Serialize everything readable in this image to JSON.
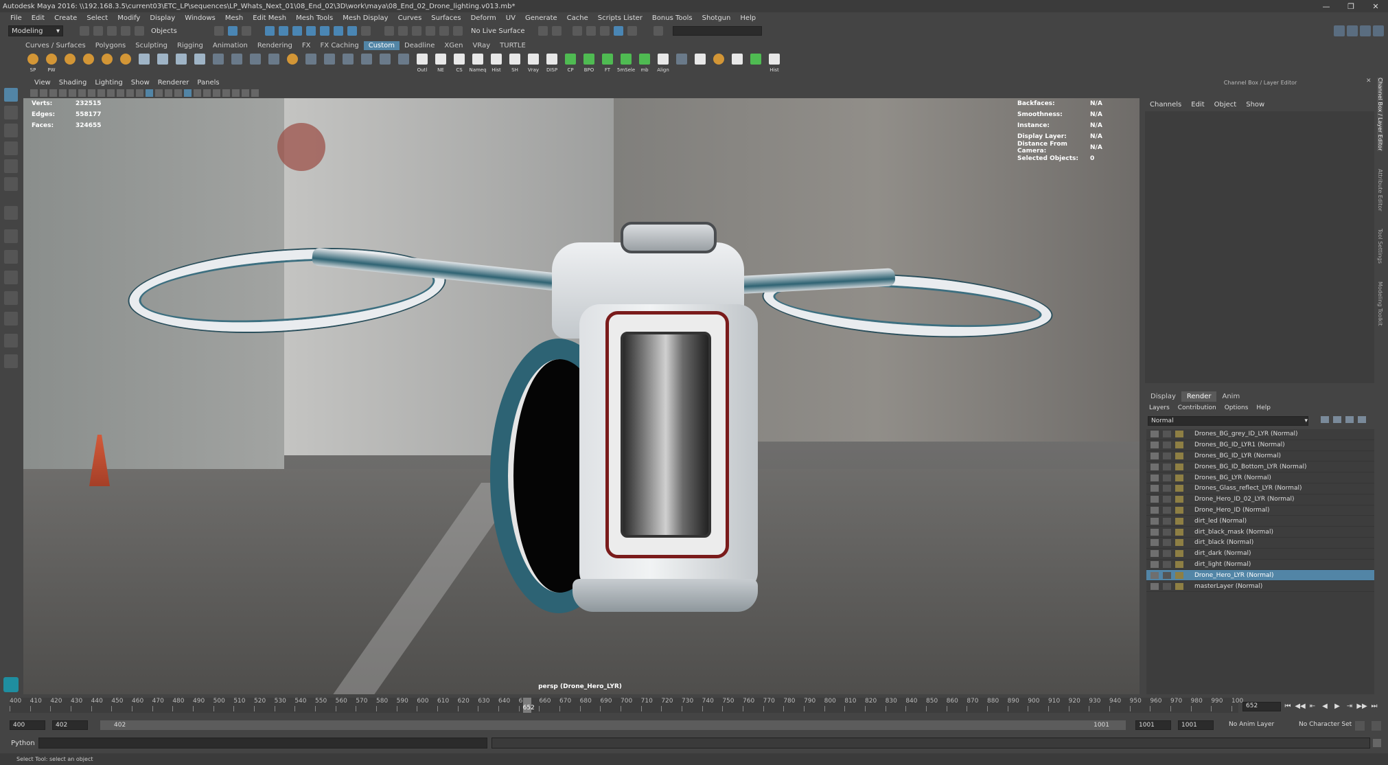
{
  "window": {
    "title": "Autodesk Maya 2016: \\\\192.168.3.5\\current03\\ETC_LP\\sequences\\LP_Whats_Next_01\\08_End_02\\3D\\work\\maya\\08_End_02_Drone_lighting.v013.mb*"
  },
  "menubar": [
    "File",
    "Edit",
    "Create",
    "Select",
    "Modify",
    "Display",
    "Windows",
    "Mesh",
    "Edit Mesh",
    "Mesh Tools",
    "Mesh Display",
    "Curves",
    "Surfaces",
    "Deform",
    "UV",
    "Generate",
    "Cache",
    "Scripts Lister",
    "Bonus Tools",
    "Shotgun",
    "Help"
  ],
  "statusline": {
    "menuset": "Modeling",
    "selection_mode": "Objects",
    "live_surface": "No Live Surface"
  },
  "shelf_tabs": [
    "Curves / Surfaces",
    "Polygons",
    "Sculpting",
    "Rigging",
    "Animation",
    "Rendering",
    "FX",
    "FX Caching",
    "Custom",
    "Deadline",
    "XGen",
    "VRay",
    "TURTLE"
  ],
  "shelf_active": "Custom",
  "shelf_buttons": [
    "SP",
    "PW",
    "",
    "",
    "",
    "",
    "",
    "",
    "",
    "",
    "",
    "",
    "",
    "",
    "",
    "",
    "",
    "",
    "",
    "",
    "",
    "Outl",
    "NE",
    "CS",
    "Nameq",
    "Hist",
    "SH",
    "Vray",
    "DISP",
    "CP",
    "BPO",
    "FT",
    "5mSele",
    "mb",
    "Align",
    "",
    "",
    "",
    "",
    "",
    "Hist"
  ],
  "viewport": {
    "menu": [
      "View",
      "Shading",
      "Lighting",
      "Show",
      "Renderer",
      "Panels"
    ],
    "hud_left": [
      {
        "label": "Verts:",
        "value": "232515"
      },
      {
        "label": "Edges:",
        "value": "558177"
      },
      {
        "label": "Faces:",
        "value": "324655"
      }
    ],
    "hud_right": [
      {
        "label": "Backfaces:",
        "value": "N/A"
      },
      {
        "label": "Smoothness:",
        "value": "N/A"
      },
      {
        "label": "Instance:",
        "value": "N/A"
      },
      {
        "label": "Display Layer:",
        "value": "N/A"
      },
      {
        "label": "Distance From Camera:",
        "value": "N/A"
      },
      {
        "label": "Selected Objects:",
        "value": "0"
      }
    ],
    "camera_label": "persp (Drone_Hero_LYR)"
  },
  "right_panel": {
    "title": "Channel Box / Layer Editor",
    "channel_menu": [
      "Channels",
      "Edit",
      "Object",
      "Show"
    ],
    "vertical_tabs": [
      "Channel Box / Layer Editor",
      "Attribute Editor",
      "Tool Settings",
      "Modeling Toolkit"
    ],
    "layer_tabs": [
      "Display",
      "Render",
      "Anim"
    ],
    "active_layer_tab": "Render",
    "layer_menu": [
      "Layers",
      "Contribution",
      "Options",
      "Help"
    ],
    "blend_mode": "Normal",
    "layers": [
      "Drones_BG_grey_ID_LYR (Normal)",
      "Drones_BG_ID_LYR1 (Normal)",
      "Drones_BG_ID_LYR (Normal)",
      "Drones_BG_ID_Bottom_LYR (Normal)",
      "Drones_BG_LYR (Normal)",
      "Drones_Glass_reflect_LYR (Normal)",
      "Drone_Hero_ID_02_LYR (Normal)",
      "Drone_Hero_ID (Normal)",
      "dirt_led (Normal)",
      "dirt_black_mask (Normal)",
      "dirt_black (Normal)",
      "dirt_dark (Normal)",
      "dirt_light (Normal)",
      "Drone_Hero_LYR (Normal)",
      "masterLayer (Normal)"
    ],
    "selected_layer_index": 13
  },
  "timeline": {
    "ticks": [
      "400",
      "410",
      "420",
      "430",
      "440",
      "450",
      "460",
      "470",
      "480",
      "490",
      "500",
      "510",
      "520",
      "530",
      "540",
      "550",
      "560",
      "570",
      "580",
      "590",
      "600",
      "610",
      "620",
      "630",
      "640",
      "650",
      "660",
      "670",
      "680",
      "690",
      "700",
      "710",
      "720",
      "730",
      "740",
      "750",
      "760",
      "770",
      "780",
      "790",
      "800",
      "810",
      "820",
      "830",
      "840",
      "850",
      "860",
      "870",
      "880",
      "890",
      "900",
      "910",
      "920",
      "930",
      "940",
      "950",
      "960",
      "970",
      "980",
      "990",
      "100"
    ],
    "current_frame": "652",
    "current_field": "652"
  },
  "range": {
    "start": "400",
    "playback_start": "402",
    "bar_start": "402",
    "bar_end": "1001",
    "playback_end": "1001",
    "end": "1001",
    "anim_layer": "No Anim Layer",
    "character_set": "No Character Set"
  },
  "command": {
    "language": "Python"
  },
  "help_line": "Select Tool: select an object"
}
